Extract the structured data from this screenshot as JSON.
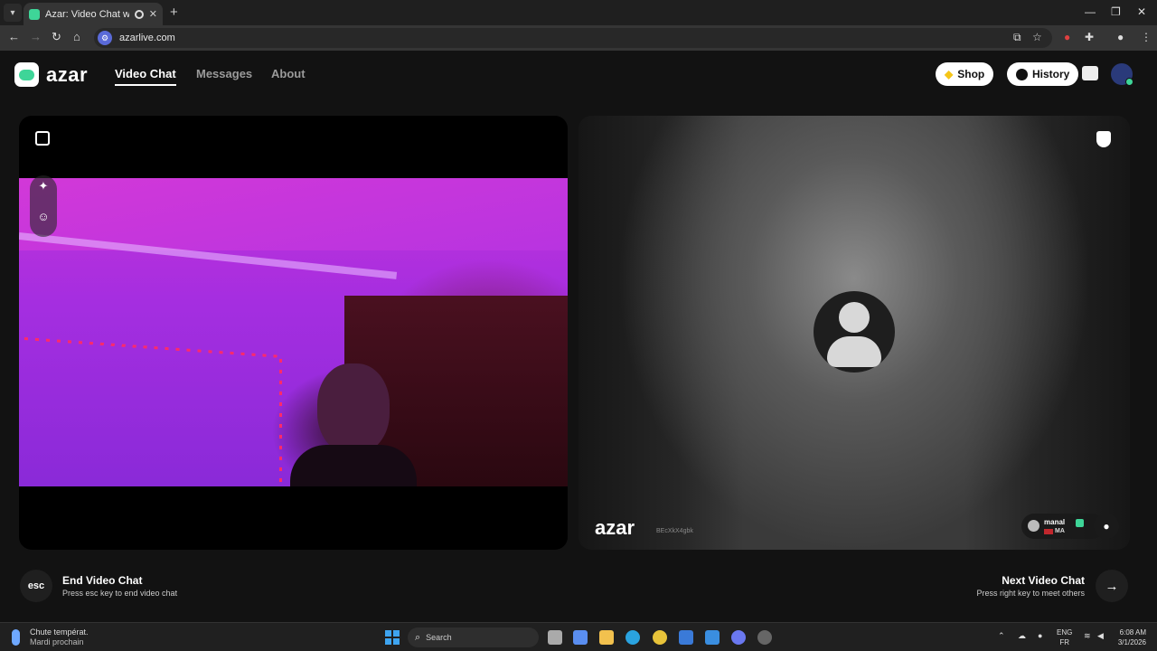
{
  "browser": {
    "tab_title": "Azar: Video Chat with New",
    "new_tab": "+",
    "url": "azarlive.com",
    "win_minimize": "—",
    "win_restore": "❐",
    "win_close": "✕"
  },
  "site": {
    "logo_text": "azar",
    "nav": [
      {
        "label": "Video Chat",
        "active": true
      },
      {
        "label": "Messages",
        "active": false
      },
      {
        "label": "About",
        "active": false
      }
    ],
    "shop_label": "Shop",
    "history_label": "History"
  },
  "partner": {
    "watermark": "azar",
    "session_id": "BEcXkX4gbk",
    "name": "manal",
    "country": "MA"
  },
  "controls": {
    "esc_label": "esc",
    "end_title": "End Video Chat",
    "end_subtitle": "Press esc key to end video chat",
    "next_title": "Next Video Chat",
    "next_subtitle": "Press right key to meet others"
  },
  "taskbar": {
    "weather_title": "Chute températ.",
    "weather_subtitle": "Mardi prochain",
    "search_placeholder": "Search",
    "lang_top": "ENG",
    "lang_bottom": "FR",
    "time": "6:08 AM",
    "date": "3/1/2026"
  },
  "colors": {
    "accent": "#3ed598",
    "background": "#121212"
  }
}
